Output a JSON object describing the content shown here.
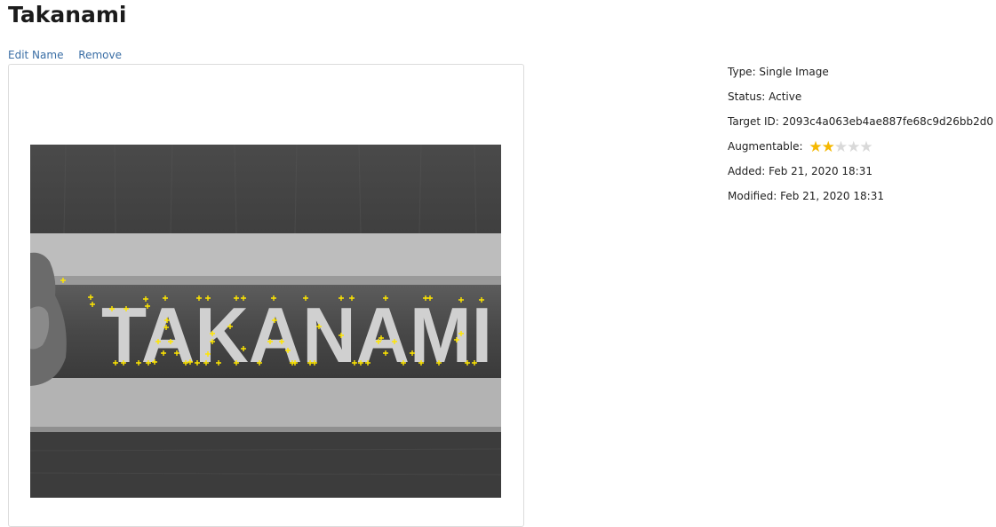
{
  "title": "Takanami",
  "actions": {
    "edit": "Edit Name",
    "remove": "Remove"
  },
  "image": {
    "word": "TAKANAMI",
    "feature_marker_color": "#ffe600"
  },
  "details": {
    "type": "Type: Single Image",
    "status": "Status: Active",
    "target_id": "Target ID: 2093c4a063eb4ae887fe68c9d26bb2d0",
    "augmentable_label": "Augmentable:",
    "augmentable_rating": 2,
    "augmentable_max": 5,
    "added": "Added: Feb 21, 2020 18:31",
    "modified": "Modified: Feb 21, 2020 18:31"
  },
  "colors": {
    "link": "#3a6ea5",
    "star_on": "#f5b800",
    "star_off": "#d9d9d9"
  }
}
